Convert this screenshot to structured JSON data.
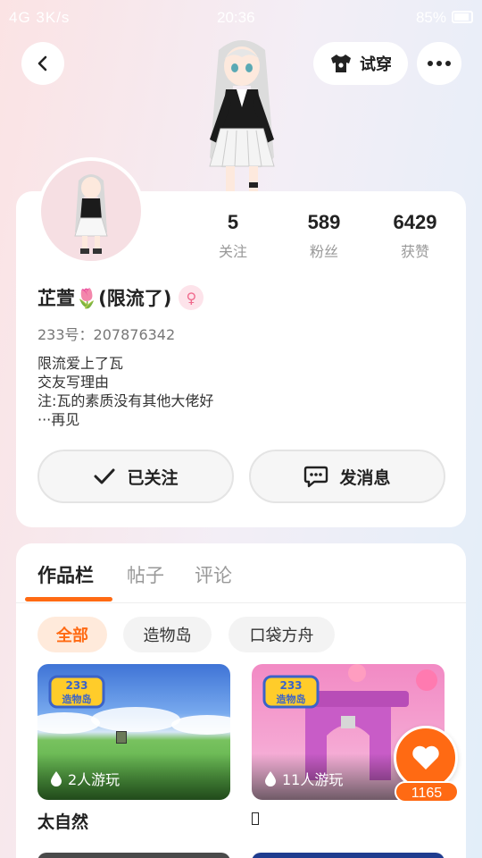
{
  "status_bar": {
    "left": "4G 3K/s",
    "time": "20:36",
    "battery": "85%"
  },
  "header": {
    "try_on_label": "试穿"
  },
  "profile": {
    "stats": [
      {
        "value": "5",
        "label": "关注"
      },
      {
        "value": "589",
        "label": "粉丝"
      },
      {
        "value": "6429",
        "label": "获赞"
      }
    ],
    "name_part1": "芷萱",
    "name_emoji": "🌷",
    "name_part2": "(限流了)",
    "uid": "233号：207876342",
    "bio": [
      "限流爱上了瓦",
      "交友写理由",
      "注:瓦的素质没有其他大佬好",
      "···再见"
    ],
    "follow_label": "已关注",
    "message_label": "发消息"
  },
  "works": {
    "tabs": [
      "作品栏",
      "帖子",
      "评论"
    ],
    "chips": [
      "全部",
      "造物岛",
      "口袋方舟"
    ],
    "games": [
      {
        "title": "太自然",
        "plays": "2人游玩"
      },
      {
        "title": "",
        "plays": "11人游玩"
      }
    ],
    "logo_text": "233造物岛",
    "like_count": "1165"
  }
}
